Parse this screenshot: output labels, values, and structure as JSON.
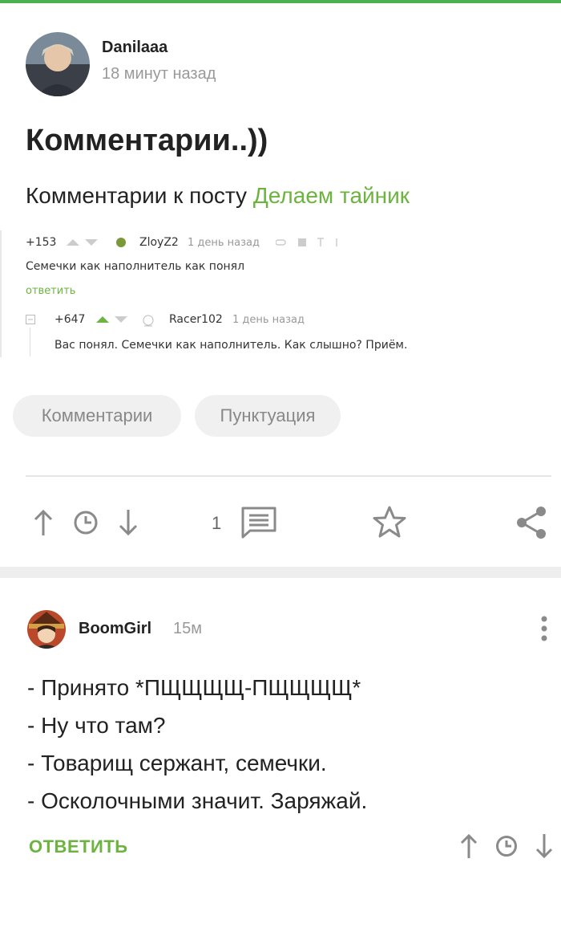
{
  "post": {
    "author": "Danilaaa",
    "time": "18 минут назад",
    "title": "Комментарии..))",
    "subtitle_prefix": "Комментарии к посту ",
    "subtitle_link": "Делаем тайник",
    "screenshot": {
      "comment1": {
        "rating": "+153",
        "author": "ZloyZ2",
        "time": "1 день назад",
        "text": "Семечки как наполнитель как понял",
        "reply": "ответить"
      },
      "comment2": {
        "rating": "+647",
        "author": "Racer102",
        "time": "1 день назад",
        "text": "Вас понял. Семечки как наполнитель. Как слышно? Приём."
      }
    },
    "tags": [
      "Комментарии",
      "Пунктуация"
    ],
    "comments_count": "1"
  },
  "comment": {
    "author": "BoomGirl",
    "time": "15м",
    "lines": [
      "- Принято *ПЩЩЩЩ-ПЩЩЩЩ*",
      "- Ну что там?",
      "- Товарищ сержант, семечки.",
      "- Осколочными значит. Заряжай."
    ],
    "reply": "ОТВЕТИТЬ"
  },
  "colors": {
    "accent": "#6cb33f",
    "icon": "#8a8a8a"
  },
  "icons": [
    "upvote-icon",
    "clock-icon",
    "downvote-icon",
    "comments-icon",
    "star-icon",
    "share-icon",
    "more-icon"
  ]
}
